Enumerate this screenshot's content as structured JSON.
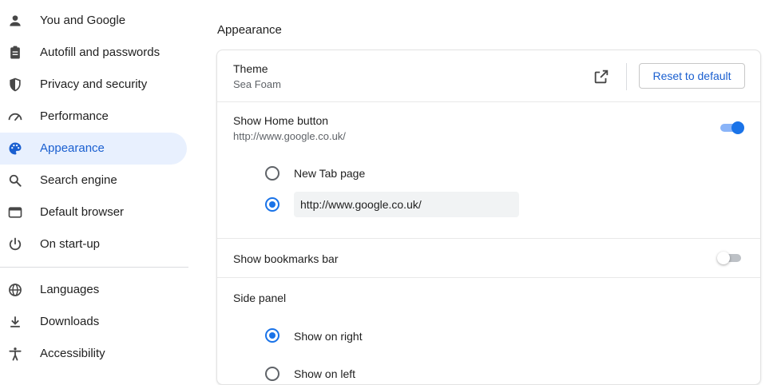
{
  "sidebar": {
    "items": [
      {
        "label": "You and Google",
        "icon": "person-icon"
      },
      {
        "label": "Autofill and passwords",
        "icon": "clipboard-icon"
      },
      {
        "label": "Privacy and security",
        "icon": "shield-icon"
      },
      {
        "label": "Performance",
        "icon": "speedometer-icon"
      },
      {
        "label": "Appearance",
        "icon": "palette-icon",
        "active": true
      },
      {
        "label": "Search engine",
        "icon": "search-icon"
      },
      {
        "label": "Default browser",
        "icon": "browser-window-icon"
      },
      {
        "label": "On start-up",
        "icon": "power-icon"
      },
      {
        "label": "Languages",
        "icon": "globe-icon"
      },
      {
        "label": "Downloads",
        "icon": "download-icon"
      },
      {
        "label": "Accessibility",
        "icon": "accessibility-icon"
      }
    ]
  },
  "main": {
    "section_title": "Appearance",
    "theme": {
      "label": "Theme",
      "value": "Sea Foam",
      "open_icon": "open-in-new-icon",
      "reset_label": "Reset to default"
    },
    "home_button": {
      "label": "Show Home button",
      "value": "http://www.google.co.uk/",
      "enabled": true,
      "options": [
        {
          "label": "New Tab page",
          "checked": false
        },
        {
          "input_value": "http://www.google.co.uk/",
          "checked": true
        }
      ]
    },
    "bookmarks_bar": {
      "label": "Show bookmarks bar",
      "enabled": false
    },
    "side_panel": {
      "label": "Side panel",
      "options": [
        {
          "label": "Show on right",
          "checked": true
        },
        {
          "label": "Show on left",
          "checked": false
        }
      ]
    }
  },
  "colors": {
    "accent": "#1a73e8",
    "active_bg": "#e8f0fe",
    "text": "#1f1f1f",
    "secondary_text": "#5f6368"
  }
}
